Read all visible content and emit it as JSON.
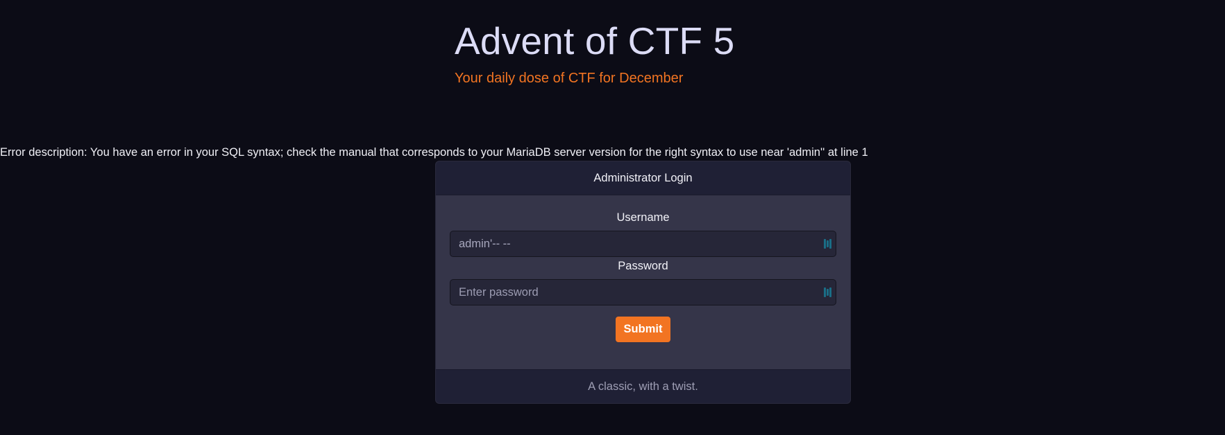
{
  "header": {
    "title": "Advent of CTF 5",
    "subtitle": "Your daily dose of CTF for December"
  },
  "error": {
    "text": "Error description: You have an error in your SQL syntax; check the manual that corresponds to your MariaDB server version for the right syntax to use near 'admin'' at line 1"
  },
  "login_card": {
    "header": "Administrator Login",
    "username_label": "Username",
    "username_value": "admin'-- --",
    "password_label": "Password",
    "password_placeholder": "Enter password",
    "password_value": "",
    "submit_label": "Submit",
    "footer": "A classic, with a twist."
  },
  "icons": {
    "field_icon": "password-manager-icon",
    "field_icon_color": "#1a6d86"
  },
  "colors": {
    "background": "#0c0c16",
    "accent": "#f27422",
    "card_body": "#353549",
    "card_header": "#1f2035"
  }
}
